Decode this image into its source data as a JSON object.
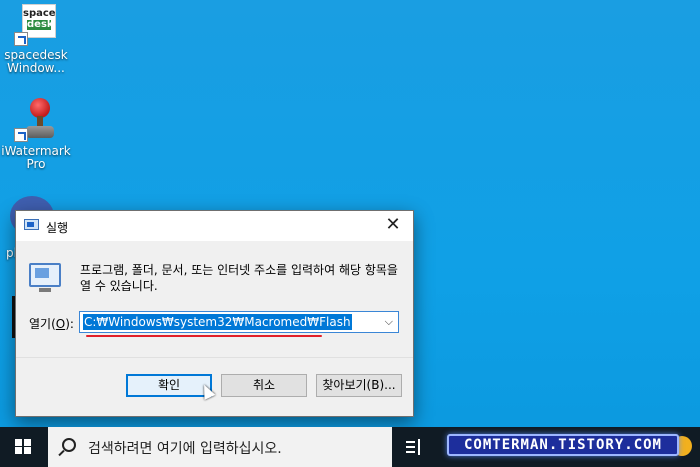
{
  "desktop": {
    "icons": [
      {
        "label": "spacedesk\nWindow...",
        "art_line1": "space",
        "art_line2": "desk"
      },
      {
        "label": "iWatermark\nPro"
      }
    ],
    "partial_text": "pl"
  },
  "run_dialog": {
    "title": "실행",
    "description": "프로그램, 폴더, 문서, 또는 인터넷 주소를 입력하여 해당 항목을 열 수 있습니다.",
    "open_label": "열기(",
    "open_label_accel": "O",
    "open_label_end": "):",
    "open_value": "C:₩Windows₩system32₩Macromed₩Flash",
    "buttons": {
      "ok": "확인",
      "cancel": "취소",
      "browse": "찾아보기(B)..."
    }
  },
  "taskbar": {
    "search_placeholder": "검색하려면 여기에 입력하십시오.",
    "watermark": "COMTERMAN.TISTORY.COM"
  },
  "colors": {
    "desktop": "#0fa0e6",
    "accent": "#0078d7",
    "highlight_underline": "#e0202a",
    "taskbar": "#101b24"
  }
}
